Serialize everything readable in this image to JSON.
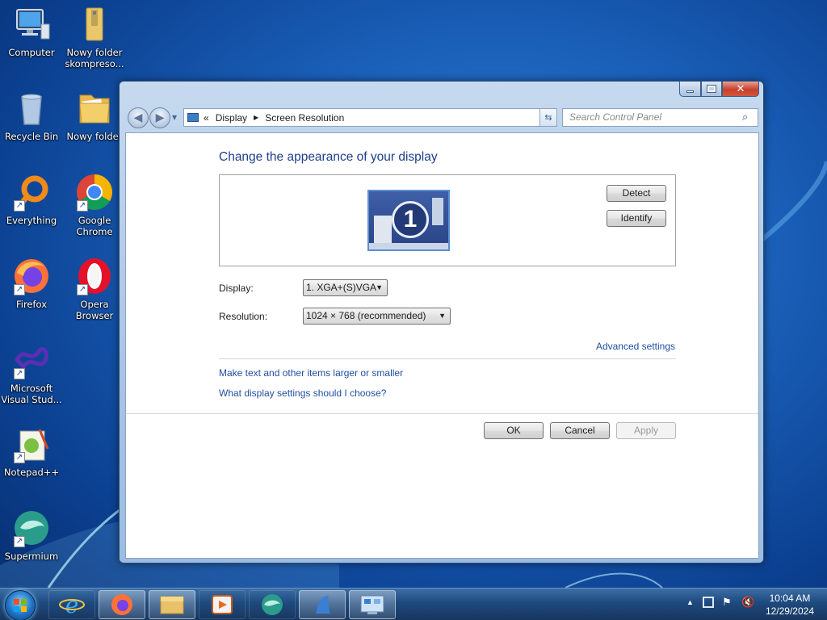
{
  "desktop": {
    "icons": [
      {
        "label_line1": "Computer",
        "label_line2": "",
        "icon": "computer-icon"
      },
      {
        "label_line1": "Nowy folder",
        "label_line2": "skompreso...",
        "icon": "folder-icon"
      },
      {
        "label_line1": "Recycle Bin",
        "label_line2": "",
        "icon": "recycle-bin-icon"
      },
      {
        "label_line1": "Nowy folder",
        "label_line2": "",
        "icon": "folder-icon"
      },
      {
        "label_line1": "Everything",
        "label_line2": "",
        "icon": "everything-icon"
      },
      {
        "label_line1": "Google",
        "label_line2": "Chrome",
        "icon": "chrome-icon"
      },
      {
        "label_line1": "Firefox",
        "label_line2": "",
        "icon": "firefox-icon"
      },
      {
        "label_line1": "Opera",
        "label_line2": "Browser",
        "icon": "opera-icon"
      },
      {
        "label_line1": "Microsoft",
        "label_line2": "Visual Stud...",
        "icon": "visual-studio-icon"
      },
      {
        "label_line1": "Notepad++",
        "label_line2": "",
        "icon": "notepad-plus-plus-icon"
      },
      {
        "label_line1": "Supermium",
        "label_line2": "",
        "icon": "supermium-icon"
      }
    ]
  },
  "window": {
    "breadcrumb": {
      "prefix": "«",
      "item1": "Display",
      "item2": "Screen Resolution"
    },
    "search_placeholder": "Search Control Panel",
    "heading": "Change the appearance of your display",
    "monitor_number": "1",
    "detect_label": "Detect",
    "identify_label": "Identify",
    "display_label": "Display:",
    "display_value": "1. XGA+(S)VGA",
    "resolution_label": "Resolution:",
    "resolution_value": "1024 × 768 (recommended)",
    "advanced_link": "Advanced settings",
    "link_text_size": "Make text and other items larger or smaller",
    "link_help": "What display settings should I choose?",
    "ok_label": "OK",
    "cancel_label": "Cancel",
    "apply_label": "Apply"
  },
  "taskbar": {
    "time": "10:04 AM",
    "date": "12/29/2024",
    "pinned": [
      "internet-explorer-icon",
      "firefox-icon",
      "file-explorer-icon",
      "media-player-icon",
      "supermium-icon",
      "app-icon",
      "control-panel-icon"
    ]
  },
  "colors": {
    "link": "#1f4fa0",
    "heading": "#1e3f8a",
    "desktop": "#1a5fb8"
  }
}
